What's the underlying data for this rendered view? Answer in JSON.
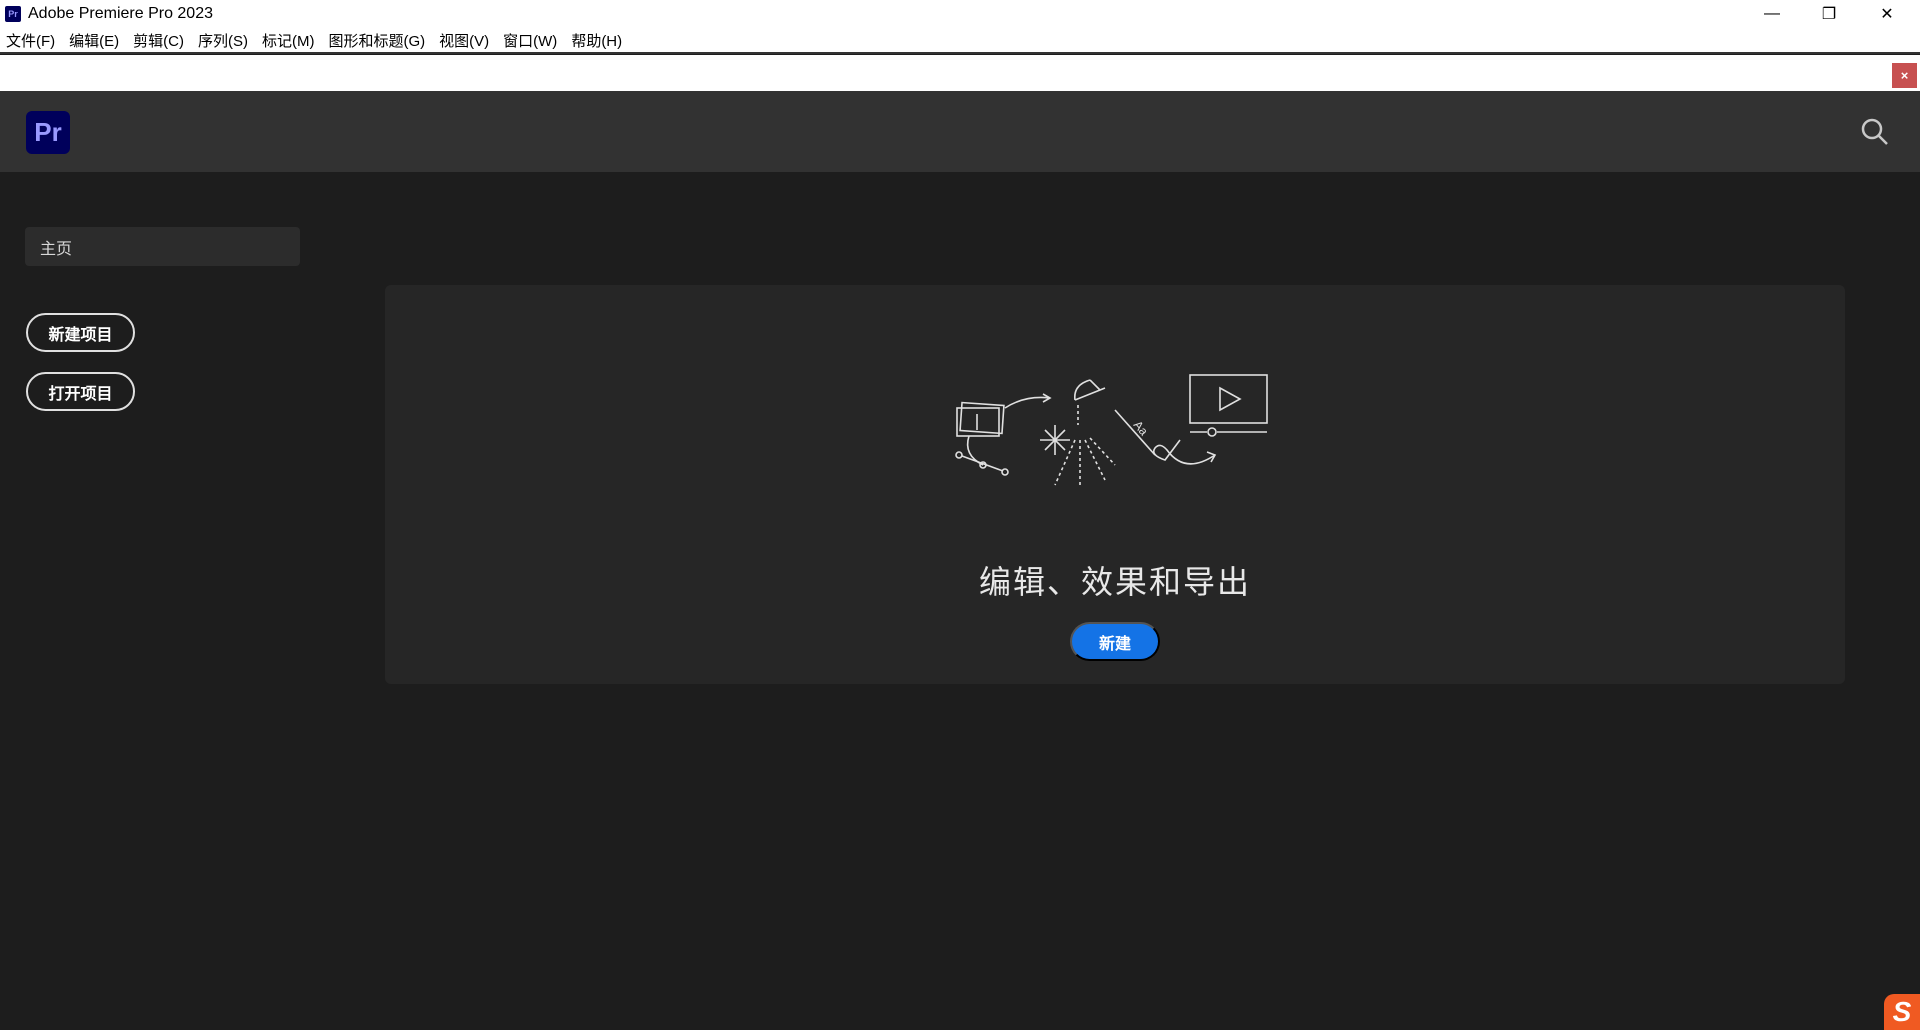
{
  "window": {
    "title": "Adobe Premiere Pro 2023",
    "app_icon": "Pr"
  },
  "menu": [
    "文件(F)",
    "编辑(E)",
    "剪辑(C)",
    "序列(S)",
    "标记(M)",
    "图形和标题(G)",
    "视图(V)",
    "窗口(W)",
    "帮助(H)"
  ],
  "notice": {
    "close": "×"
  },
  "header": {
    "logo": "Pr"
  },
  "sidebar": {
    "home": "主页",
    "new_project": "新建项目",
    "open_project": "打开项目"
  },
  "card": {
    "title": "编辑、效果和导出",
    "new_button": "新建"
  },
  "tray": {
    "ime": "S"
  },
  "colors": {
    "accent": "#1473e6",
    "header": "#323232",
    "bg": "#1d1d1d",
    "card": "#262626"
  }
}
